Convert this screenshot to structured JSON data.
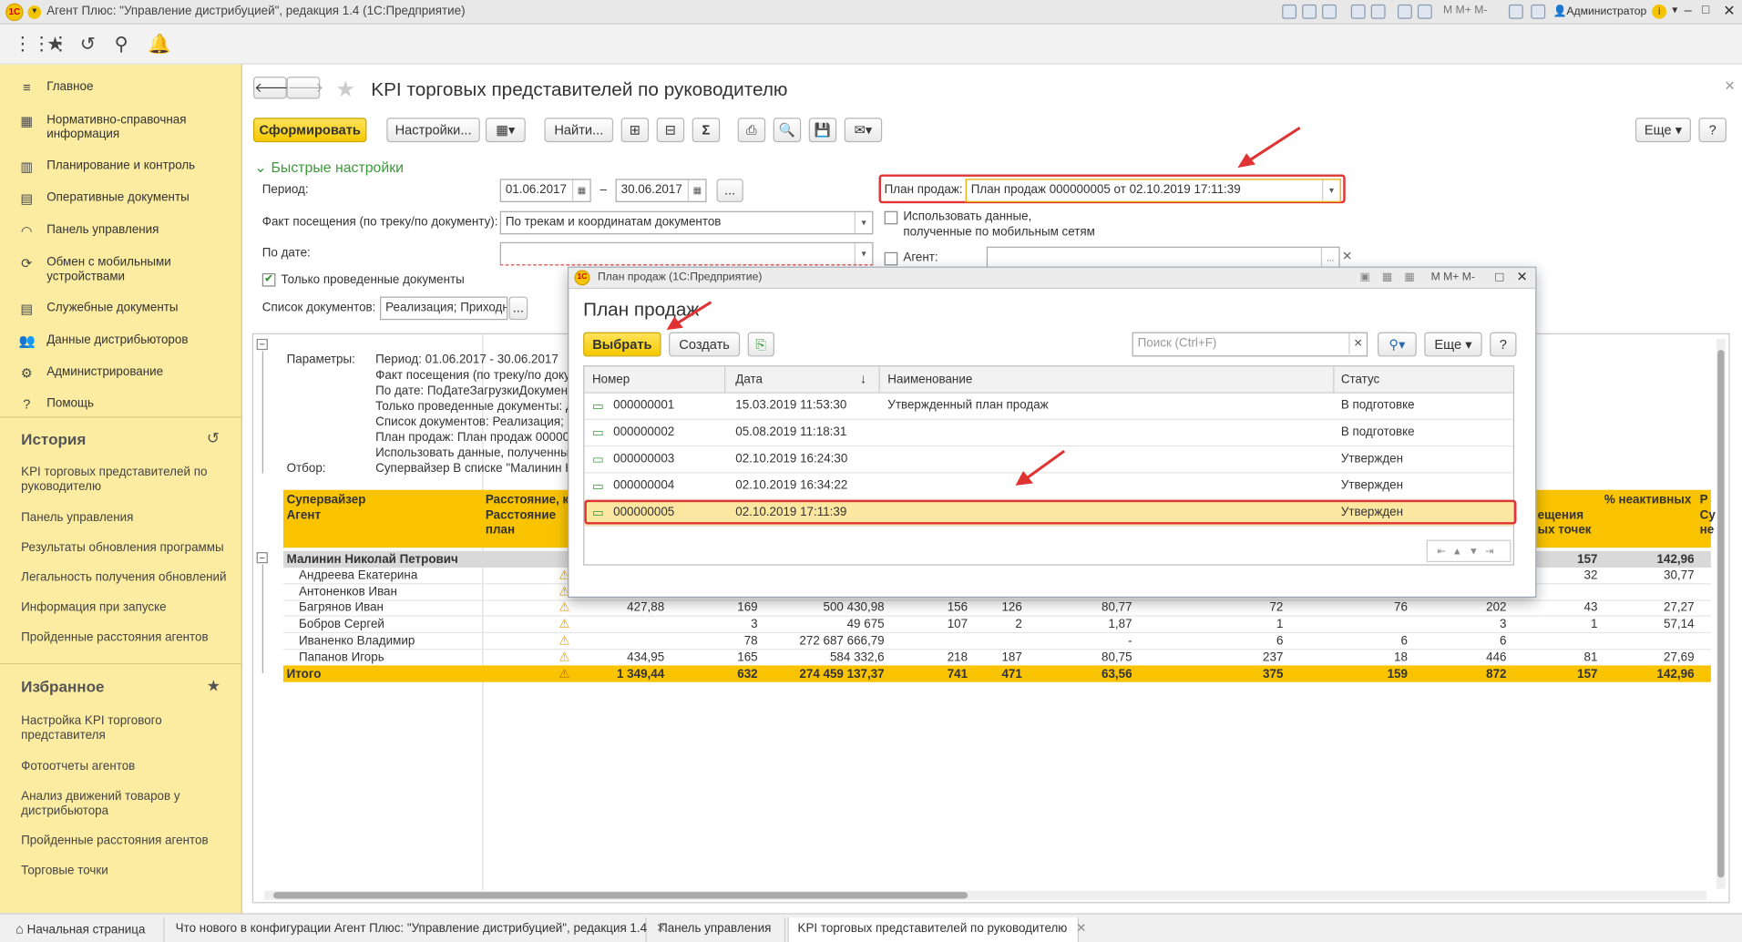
{
  "window": {
    "title": "Агент Плюс: \"Управление дистрибуцией\", редакция 1.4  (1С:Предприятие)",
    "user": "Администратор"
  },
  "sidebar": {
    "items": [
      {
        "label": "Главное",
        "icon": "menu-icon"
      },
      {
        "label": "Нормативно-справочная информация",
        "icon": "book-icon"
      },
      {
        "label": "Планирование и контроль",
        "icon": "chart-icon"
      },
      {
        "label": "Оперативные документы",
        "icon": "documents-icon"
      },
      {
        "label": "Панель управления",
        "icon": "gauge-icon"
      },
      {
        "label": "Обмен с мобильными устройствами",
        "icon": "sync-icon"
      },
      {
        "label": "Служебные документы",
        "icon": "documents-icon"
      },
      {
        "label": "Данные дистрибьюторов",
        "icon": "people-icon"
      },
      {
        "label": "Администрирование",
        "icon": "gear-icon"
      },
      {
        "label": "Помощь",
        "icon": "help-icon"
      }
    ],
    "history_title": "История",
    "history": [
      "KPI торговых представителей по руководителю",
      "Панель управления",
      "Результаты обновления программы",
      "Легальность получения обновлений",
      "Информация при запуске",
      "Пройденные расстояния агентов"
    ],
    "favorites_title": "Избранное",
    "favorites": [
      "Настройка KPI торгового представителя",
      "Фотоотчеты агентов",
      "Анализ движений товаров у дистрибьютора",
      "Пройденные расстояния агентов",
      "Торговые точки"
    ]
  },
  "main": {
    "title": "KPI торговых представителей по руководителю",
    "toolbar": {
      "generate": "Сформировать",
      "settings": "Настройки...",
      "find": "Найти...",
      "more": "Еще",
      "help": "?"
    },
    "quick_settings": "Быстрые настройки",
    "period_label": "Период:",
    "period_from": "01.06.2017",
    "period_dash": "–",
    "period_to": "30.06.2017",
    "period_btn": "...",
    "fact_label": "Факт посещения (по треку/по документу):",
    "fact_value": "По трекам и координатам документов",
    "bydate_label": "По дате:",
    "only_posted": "Только проведенные документы",
    "doclist_label": "Список документов:",
    "doclist_value": "Реализация; Приходні",
    "plan_label": "План продаж:",
    "plan_value": "План продаж 000000005 от 02.10.2019 17:11:39",
    "use_mobile_1": "Использовать данные,",
    "use_mobile_2": "полученные по мобильным сетям",
    "agent_label": "Агент:"
  },
  "report": {
    "params_label": "Параметры:",
    "params": [
      "Период: 01.06.2017 - 30.06.2017",
      "Факт посещения (по треку/по доку",
      "По дате: ПоДатеЗагрузкиДокумент",
      "Только проведенные документы: Д",
      "Список документов: Реализация; П",
      "План продаж: План продаж 000000",
      "Использовать данные, полученные"
    ],
    "filter_label": "Отбор:",
    "filter_value": "Супервайзер В списке \"Малинин Н",
    "headers": {
      "supervisor": "Супервайзер",
      "agent": "Агент",
      "distance": "Расстояние, к",
      "distance_plan_1": "Расстояние",
      "distance_plan_2": "план",
      "visits_1": "ещения",
      "visits_2": "ых точек",
      "inactive": "% неактивных",
      "extra_1": "Р",
      "extra_2": "Су",
      "extra_3": "не"
    },
    "group": {
      "name": "Малинин Николай Петрович",
      "c9": "157",
      "c10": "142,96"
    },
    "rows": [
      {
        "name": "Андреева Екатерина",
        "dist": "",
        "c1": "",
        "c2": "",
        "c3": "",
        "c4": "",
        "c5": "",
        "c6": "",
        "c7": "",
        "c8": "",
        "c9": "32",
        "c10": "30,77"
      },
      {
        "name": "Антоненков Иван",
        "dist": "",
        "c1": "",
        "c2": "",
        "c3": "",
        "c4": "",
        "c5": "",
        "c6": "",
        "c7": "",
        "c8": "",
        "c9": "",
        "c10": ""
      },
      {
        "name": "Багрянов Иван",
        "dist": "427,88",
        "c1": "169",
        "c2": "500 430,98",
        "c3": "156",
        "c4": "126",
        "c5": "80,77",
        "c6": "72",
        "c7": "76",
        "c8": "202",
        "c9": "43",
        "c10": "27,27"
      },
      {
        "name": "Бобров Сергей",
        "dist": "",
        "c1": "3",
        "c2": "49 675",
        "c3": "107",
        "c4": "2",
        "c5": "1,87",
        "c6": "1",
        "c7": "",
        "c8": "3",
        "c9": "1",
        "c10": "57,14"
      },
      {
        "name": "Иваненко Владимир",
        "dist": "",
        "c1": "78",
        "c2": "272 687 666,79",
        "c3": "",
        "c4": "",
        "c5": "-",
        "c6": "6",
        "c7": "6",
        "c8": "6",
        "c9": "",
        "c10": ""
      },
      {
        "name": "Папанов Игорь",
        "dist": "434,95",
        "c1": "165",
        "c2": "584 332,6",
        "c3": "218",
        "c4": "187",
        "c5": "80,75",
        "c6": "237",
        "c7": "18",
        "c8": "446",
        "c9": "81",
        "c10": "27,69"
      }
    ],
    "total": {
      "name": "Итого",
      "dist": "1 349,44",
      "c1": "632",
      "c2": "274 459 137,37",
      "c3": "741",
      "c4": "471",
      "c5": "63,56",
      "c6": "375",
      "c7": "159",
      "c8": "872",
      "c9": "157",
      "c10": "142,96"
    }
  },
  "modal": {
    "window_title": "План продаж  (1С:Предприятие)",
    "heading": "План продаж",
    "select": "Выбрать",
    "create": "Создать",
    "search_placeholder": "Поиск (Ctrl+F)",
    "more": "Еще",
    "help": "?",
    "columns": {
      "number": "Номер",
      "date": "Дата",
      "name": "Наименование",
      "status": "Статус"
    },
    "rows": [
      {
        "number": "000000001",
        "date": "15.03.2019 11:53:30",
        "name": "Утвержденный план продаж",
        "status": "В подготовке"
      },
      {
        "number": "000000002",
        "date": "05.08.2019 11:18:31",
        "name": "",
        "status": "В подготовке"
      },
      {
        "number": "000000003",
        "date": "02.10.2019 16:24:30",
        "name": "",
        "status": "Утвержден"
      },
      {
        "number": "000000004",
        "date": "02.10.2019 16:34:22",
        "name": "",
        "status": "Утвержден"
      },
      {
        "number": "000000005",
        "date": "02.10.2019 17:11:39",
        "name": "",
        "status": "Утвержден"
      }
    ]
  },
  "tabs": [
    "Начальная страница",
    "Что нового в конфигурации Агент Плюс: \"Управление дистрибуцией\", редакция 1.4",
    "Панель управления",
    "KPI торговых представителей по руководителю"
  ],
  "colors": {
    "accent_yellow": "#f5c900",
    "sidebar": "#fbeca1",
    "highlight": "#e03333",
    "total_row": "#f9c300"
  }
}
